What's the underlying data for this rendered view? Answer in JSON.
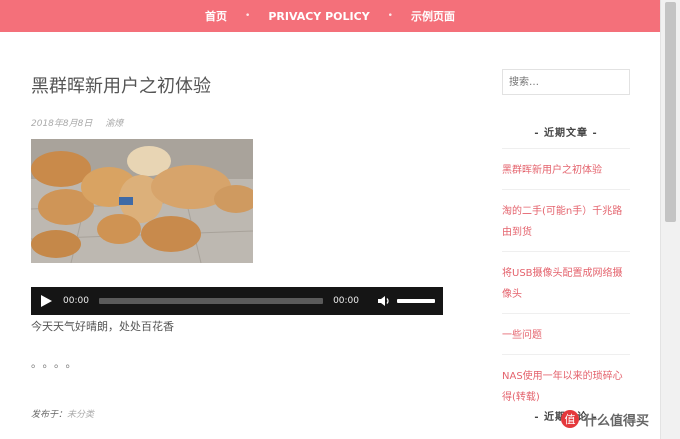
{
  "nav": {
    "items": [
      "首页",
      "PRIVACY POLICY",
      "示例页面"
    ],
    "separator": "•"
  },
  "post": {
    "title": "黑群晖新用户之初体验",
    "date": "2018年8月8日",
    "author": "渝燎",
    "audio": {
      "current_time": "00:00",
      "duration": "00:00"
    },
    "text": "今天天气好晴朗，处处百花香",
    "dots": "。。。。",
    "category_label": "发布于：",
    "category": "未分类"
  },
  "sidebar": {
    "search_placeholder": "搜索…",
    "recent_title": "- 近期文章 -",
    "recent_posts": [
      "黑群晖新用户之初体验",
      "淘的二手(可能n手）千兆路由到货",
      "将USB摄像头配置成网络摄像头",
      "一些问题",
      "NAS使用一年以来的琐碎心得(转载)"
    ],
    "comments_title": "- 近期评论 -"
  },
  "watermark": {
    "text": "什么值得买"
  },
  "colors": {
    "accent": "#f4707a",
    "link": "#e4636d"
  }
}
